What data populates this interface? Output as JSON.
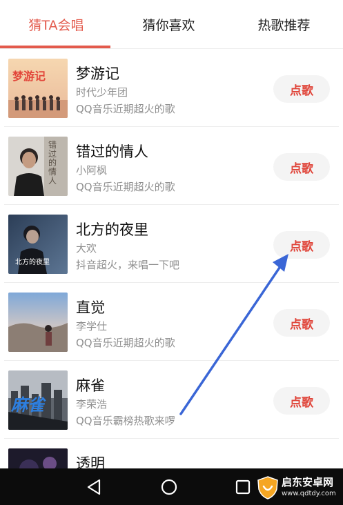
{
  "tabs": [
    {
      "label": "猜TA会唱",
      "active": true
    },
    {
      "label": "猜你喜欢",
      "active": false
    },
    {
      "label": "热歌推荐",
      "active": false
    }
  ],
  "songs": [
    {
      "title": "梦游记",
      "artist": "时代少年团",
      "desc": "QQ音乐近期超火的歌",
      "button": "点歌",
      "cover_text": "梦游记"
    },
    {
      "title": "错过的情人",
      "artist": "小阿枫",
      "desc": "QQ音乐近期超火的歌",
      "button": "点歌",
      "cover_text": "错过的情人"
    },
    {
      "title": "北方的夜里",
      "artist": "大欢",
      "desc": "抖音超火，来唱一下吧",
      "button": "点歌",
      "cover_text": "北方的夜里"
    },
    {
      "title": "直觉",
      "artist": "李学仕",
      "desc": "QQ音乐近期超火的歌",
      "button": "点歌",
      "cover_text": ""
    },
    {
      "title": "麻雀",
      "artist": "李荣浩",
      "desc": "QQ音乐霸榜热歌来啰",
      "button": "点歌",
      "cover_text": "麻雀"
    },
    {
      "title": "透明",
      "artist": "",
      "desc": "",
      "button": "",
      "cover_text": ""
    }
  ],
  "navbar": {
    "icons": [
      "back-icon",
      "home-icon",
      "recents-icon"
    ]
  },
  "watermark": {
    "name": "启东安卓网",
    "url": "www.qdtdy.com"
  },
  "colors": {
    "accent": "#e35a4c",
    "button_text": "#e0453a",
    "button_bg": "#f4f4f4",
    "arrow": "#3a66d6"
  }
}
